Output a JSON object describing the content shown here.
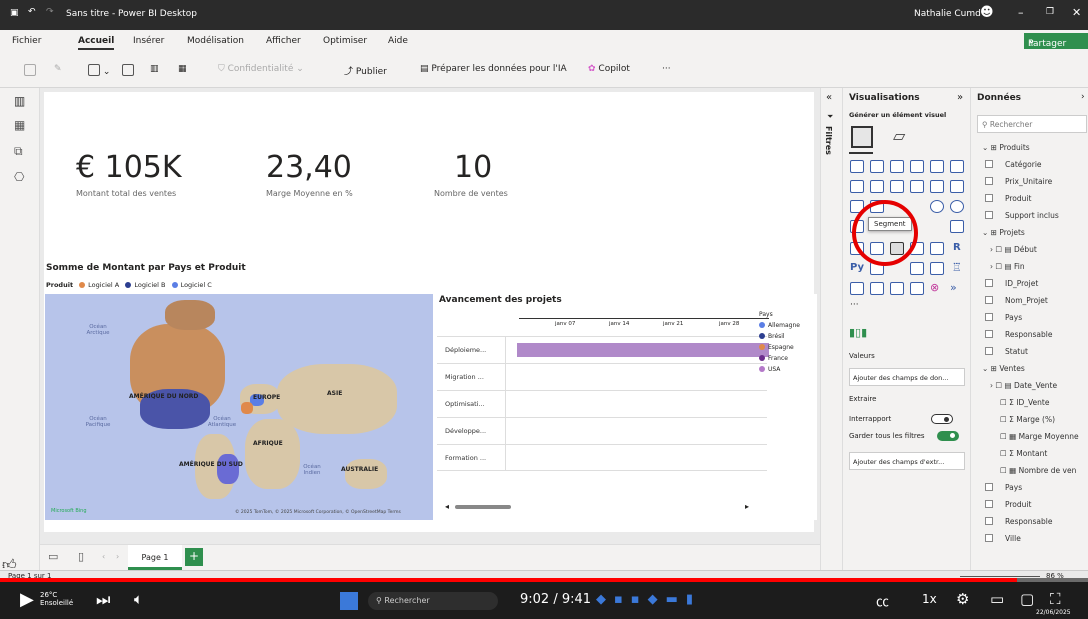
{
  "titlebar": {
    "title": "Sans titre - Power BI Desktop",
    "user": "Nathalie Cumd"
  },
  "menu": [
    "Fichier",
    "Accueil",
    "Insérer",
    "Modélisation",
    "Afficher",
    "Optimiser",
    "Aide"
  ],
  "share_label": "Partager",
  "ribbon": {
    "confidentiality": "Confidentialité",
    "publish": "Publier",
    "prepare": "Préparer les données pour l'IA",
    "copilot": "Copilot",
    "more": "···"
  },
  "kpis": [
    {
      "value": "€ 105K",
      "label": "Montant total des ventes"
    },
    {
      "value": "23,40",
      "label": "Marge Moyenne en %"
    },
    {
      "value": "10",
      "label": "Nombre de ventes"
    }
  ],
  "map": {
    "title": "Somme de Montant par Pays et Produit",
    "legend_title": "Produit",
    "legend": [
      {
        "name": "Logiciel A",
        "color": "#e0894a"
      },
      {
        "name": "Logiciel B",
        "color": "#2c3e90"
      },
      {
        "name": "Logiciel C",
        "color": "#5b7ee5"
      }
    ],
    "continents": [
      "AMÉRIQUE DU NORD",
      "EUROPE",
      "ASIE",
      "AFRIQUE",
      "AMÉRIQUE DU SUD",
      "AUSTRALIE"
    ],
    "oceans": [
      "Océan Arctique",
      "Océan Pacifique",
      "Océan Atlantique",
      "Océan Indien"
    ],
    "attribution": "© 2025 TomTom, © 2025 Microsoft Corporation, © OpenStreetMap Terms",
    "brand": "Microsoft Bing"
  },
  "gantt": {
    "title": "Avancement des projets",
    "dates": [
      "janv 07",
      "janv 14",
      "janv 21",
      "janv 28"
    ],
    "rows": [
      "Déploieme...",
      "Migration ...",
      "Optimisati...",
      "Développe...",
      "Formation ..."
    ],
    "legend_title": "Pays",
    "legend": [
      {
        "name": "Allemagne",
        "color": "#5b7ee5"
      },
      {
        "name": "Brésil",
        "color": "#2c3e90"
      },
      {
        "name": "Espagne",
        "color": "#e0894a"
      },
      {
        "name": "France",
        "color": "#6b2d8c"
      },
      {
        "name": "USA",
        "color": "#b479c9"
      }
    ]
  },
  "pagetab": {
    "label": "Page 1",
    "add": "+"
  },
  "filters_label": "Filtres",
  "viz": {
    "title": "Visualisations",
    "subtitle": "Générer un élément visuel",
    "tooltip": "Segment",
    "values_label": "Valeurs",
    "values_placeholder": "Ajouter des champs de don...",
    "extract": "Extraire",
    "crossreport": "Interrapport",
    "keepfilters": "Garder tous les filtres",
    "drill_placeholder": "Ajouter des champs d'extr..."
  },
  "data": {
    "title": "Données",
    "search": "Rechercher",
    "tables": [
      {
        "name": "Produits",
        "fields": [
          "Catégorie",
          "Prix_Unitaire",
          "Produit",
          "Support inclus"
        ]
      },
      {
        "name": "Projets",
        "fields": [
          "Début",
          "Fin",
          "ID_Projet",
          "Nom_Projet",
          "Pays",
          "Responsable",
          "Statut"
        ]
      },
      {
        "name": "Ventes",
        "fields": [
          "Date_Vente",
          "ID_Vente",
          "Marge (%)",
          "Marge Moyenne",
          "Montant",
          "Nombre de ven",
          "Pays",
          "Produit",
          "Responsable",
          "Ville"
        ]
      }
    ]
  },
  "status": {
    "page": "Page 1 sur 1",
    "zoom": "86 %"
  },
  "player": {
    "time": "9:02 / 9:41",
    "speed": "1x",
    "search": "Rechercher",
    "weather": "26°C",
    "weather_desc": "Ensoleillé",
    "date": "22/06/2025"
  },
  "progress_fraction": 0.935
}
